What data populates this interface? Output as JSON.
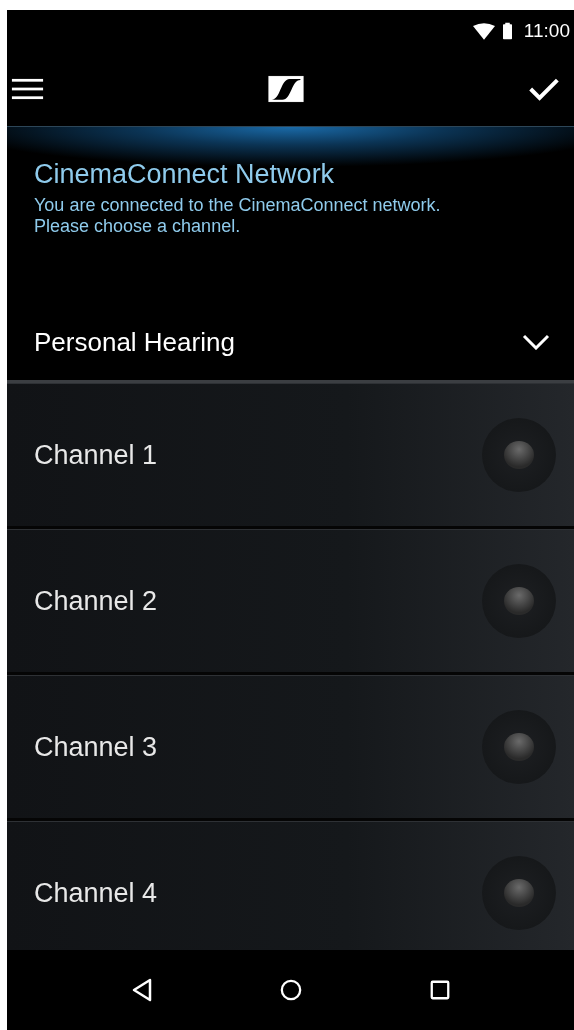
{
  "status_bar": {
    "time": "11:00"
  },
  "header": {
    "title": "CinemaConnect Network",
    "message": "You are connected to the CinemaConnect network.\nPlease choose a channel."
  },
  "mode": {
    "label": "Personal Hearing",
    "expanded": false
  },
  "channels": [
    {
      "name": "Channel 1",
      "selected": false
    },
    {
      "name": "Channel 2",
      "selected": false
    },
    {
      "name": "Channel 3",
      "selected": false
    },
    {
      "name": "Channel 4",
      "selected": false
    }
  ]
}
